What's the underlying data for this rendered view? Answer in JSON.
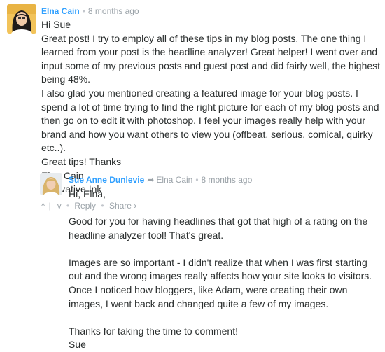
{
  "comments": [
    {
      "author": "Elna Cain",
      "time": "8 months ago",
      "lines": [
        "Hi Sue",
        "Great post! I try to employ all of these tips in my blog posts. The one thing I learned from your post is the headline analyzer! Great helper! I went over and input some of my previous posts and guest post and did fairly well, the highest being 48%.",
        "I also glad you mentioned creating a featured image for your blog posts. I spend a lot of time trying to find the right picture for each of my blog posts and then go on to edit it with photoshop. I feel your images really help with your brand and how you want others to view you (offbeat, serious, comical, quirky etc..).",
        "Great tips! Thanks",
        "Elna Cain",
        "Innovative Ink"
      ],
      "footer": {
        "upvote": "^",
        "downvote": "v",
        "reply": "Reply",
        "share": "Share ›"
      }
    },
    {
      "author": "Sue Anne Dunlevie",
      "reply_to": "Elna Cain",
      "time": "8 months ago",
      "paragraphs": [
        "Hi, Elna,",
        "Good for you for having headlines that got that high of a rating on the headline analyzer tool! That's great.",
        "Images are so important - I didn't realize that when I was first starting out and the wrong images really affects how your site looks to visitors. Once I noticed how bloggers, like Adam, were creating their own images, I went back and changed quite a few of my images."
      ],
      "signoff": [
        "Thanks for taking the time to comment!",
        "Sue"
      ]
    }
  ],
  "icons": {
    "reply_arrow": "reply-arrow-icon",
    "separator": "bullet"
  }
}
